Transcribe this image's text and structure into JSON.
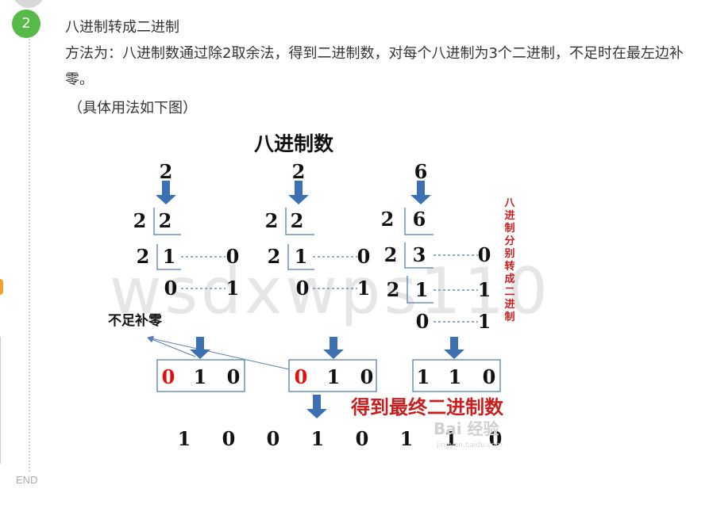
{
  "step": {
    "number": "2",
    "title": "八进制转成二进制",
    "description": "方法为：八进制数通过除2取余法，得到二进制数，对每个八进制为3个二进制，不足时在最左边补零。",
    "note": "（具体用法如下图）"
  },
  "end_label": "END",
  "figure": {
    "title": "八进制数",
    "digits": [
      "2",
      "2",
      "6"
    ],
    "divisor": "2",
    "quotients": [
      [
        "2",
        "1",
        "0"
      ],
      [
        "2",
        "1",
        "0"
      ],
      [
        "6",
        "3",
        "1",
        "0"
      ]
    ],
    "remainders": [
      [
        "0",
        "1"
      ],
      [
        "0",
        "1"
      ],
      [
        "0",
        "1",
        "1"
      ]
    ],
    "pad_label": "不足补零",
    "side_label": "八进制分别转成二进制",
    "groups": [
      [
        "0",
        "1",
        "0"
      ],
      [
        "0",
        "1",
        "0"
      ],
      [
        "1",
        "1",
        "0"
      ]
    ],
    "padded_digit_color": "#e01010",
    "result_label": "得到最终二进制数",
    "result_bits": [
      "1",
      "0",
      "0",
      "1",
      "0",
      "1",
      "1",
      "0"
    ],
    "watermark": "wsdxwps110",
    "logo_text": "Bai 经验",
    "logo_sub": "jingyan.baidu.com",
    "arrow_color": "#3d6fb3",
    "red_color": "#c81e1e"
  }
}
